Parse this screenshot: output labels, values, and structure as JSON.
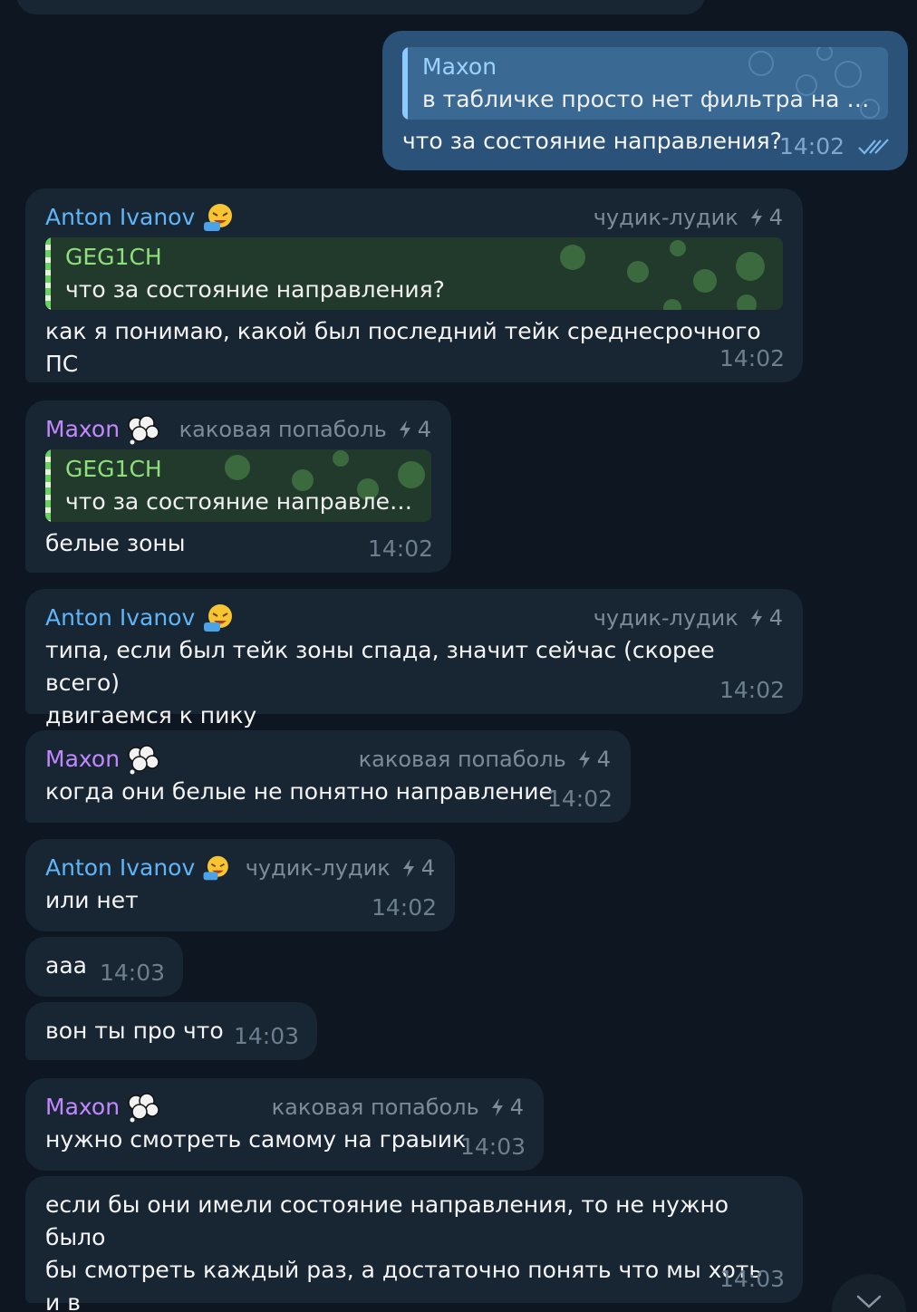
{
  "colors": {
    "background": "#0e1621",
    "incoming_bubble": "#182533",
    "outgoing_bubble": "#2b5278",
    "anton_name": "#5eb5f7",
    "maxon_name": "#c289ff",
    "reply_green_name": "#8ee07a",
    "meta_gray": "#6d7f8f"
  },
  "messages": [
    {
      "id": "m1",
      "direction": "out",
      "reply": {
        "name": "Maxon",
        "text": "в табличке просто нет фильтра на сос…"
      },
      "text": "что за состояние направления?",
      "time": "14:02",
      "status_icon": "double-check-icon"
    },
    {
      "id": "m2",
      "sender": "Anton Ivanov",
      "rank": "чудик-лудик",
      "rank_level": "4",
      "reply": {
        "name": "GEG1CH",
        "text": "что за состояние направления?"
      },
      "text": "как я понимаю, какой был последний тейк среднесрочного ПС",
      "time": "14:02"
    },
    {
      "id": "m3",
      "sender": "Maxon",
      "rank": "каковая попаболь",
      "rank_level": "4",
      "reply": {
        "name": "GEG1CH",
        "text": "что за состояние направлен…"
      },
      "text": "белые зоны",
      "time": "14:02"
    },
    {
      "id": "m4",
      "sender": "Anton Ivanov",
      "rank": "чудик-лудик",
      "rank_level": "4",
      "text": "типа, если был тейк зоны спада, значит сейчас (скорее всего)\nдвигаемся к пику",
      "time": "14:02"
    },
    {
      "id": "m5",
      "sender": "Maxon",
      "rank": "каковая попаболь",
      "rank_level": "4",
      "text": "когда они белые не понятно направление",
      "time": "14:02"
    },
    {
      "id": "m6",
      "sender": "Anton Ivanov",
      "rank": "чудик-лудик",
      "rank_level": "4",
      "text": "или нет",
      "time": "14:02"
    },
    {
      "id": "m7",
      "text": "ааа",
      "time": "14:03"
    },
    {
      "id": "m8",
      "text": "вон ты про что",
      "time": "14:03"
    },
    {
      "id": "m9",
      "sender": "Maxon",
      "rank": "каковая попаболь",
      "rank_level": "4",
      "text": "нужно смотреть самому на граыик",
      "time": "14:03"
    },
    {
      "id": "m10",
      "text": "если бы они имели состояние направления, то не нужно было\nбы смотреть каждый раз, а достаточно понять что мы хоть и в\nцентре но в писходящем направлении",
      "time": "14:03"
    }
  ],
  "scroll_button_icon": "chevron-down-icon"
}
